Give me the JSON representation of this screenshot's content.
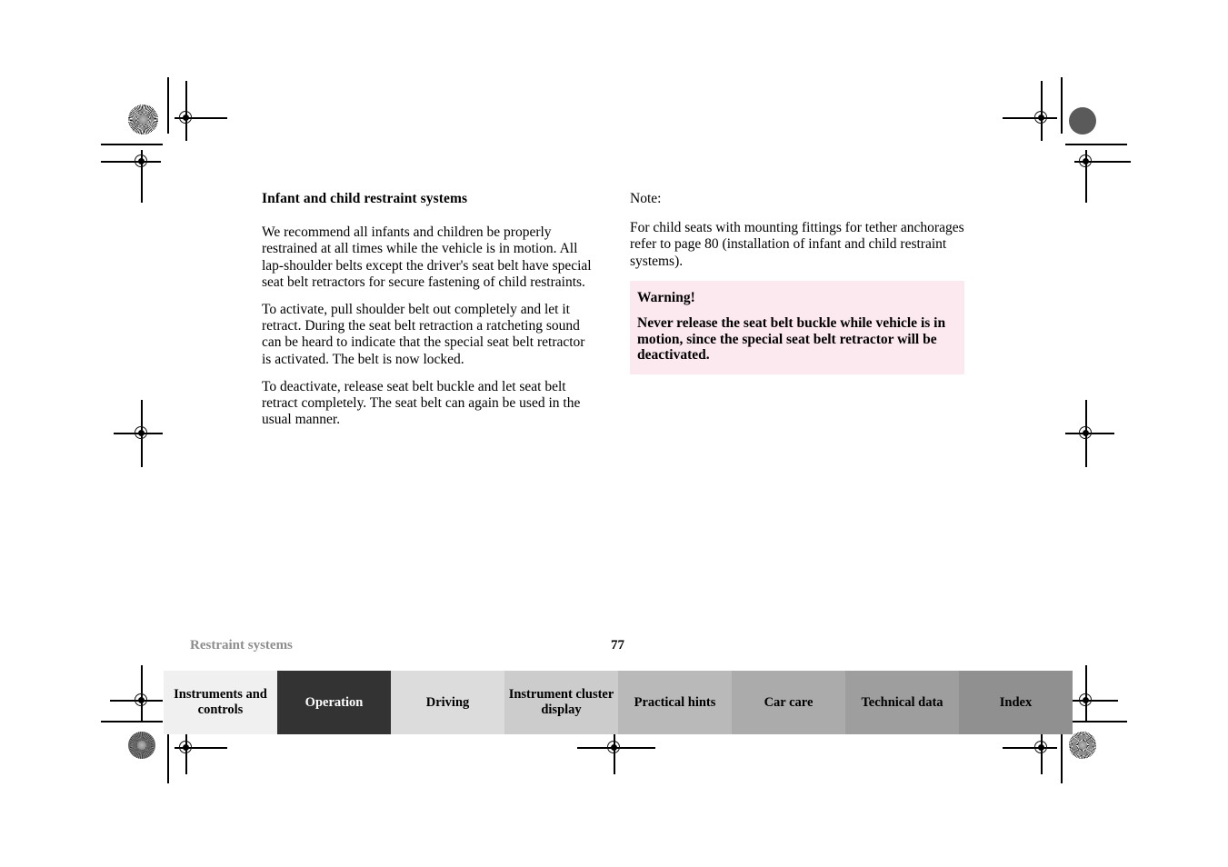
{
  "document": {
    "type": "vehicle-owners-manual-page",
    "page_number": "77",
    "footer_section": "Restraint systems"
  },
  "left_column": {
    "heading": "Infant and child restraint systems",
    "paragraphs": [
      "We recommend all infants and children be properly restrained at all times while the vehicle is in motion. All lap-shoulder belts except the driver's seat belt have special seat belt retractors for secure fastening of child restraints.",
      "To activate, pull shoulder belt out completely and let it retract. During the seat belt retraction a ratcheting sound can be heard to indicate that the special seat belt retractor is activated. The belt is now locked.",
      "To deactivate, release seat belt buckle and let seat belt retract completely. The seat belt can again be used in the usual manner."
    ]
  },
  "right_column": {
    "note_label": "Note:",
    "note_text": "For child seats with mounting fittings for tether anchorages refer to page 80 (installation of infant and child restraint systems).",
    "warning": {
      "title": "Warning!",
      "text": "Never release the seat belt buckle while vehicle is in motion, since the special seat belt retractor will be deactivated.",
      "background_color": "#fce9ef"
    }
  },
  "tab_bar": {
    "tabs": [
      {
        "label": "Instruments and controls",
        "color": "#f0f0f0",
        "active": false
      },
      {
        "label": "Operation",
        "color": "#333333",
        "active": true
      },
      {
        "label": "Driving",
        "color": "#dcdcdc",
        "active": false
      },
      {
        "label": "Instrument cluster display",
        "color": "#cccccc",
        "active": false
      },
      {
        "label": "Practical hints",
        "color": "#b9b9b9",
        "active": false
      },
      {
        "label": "Car care",
        "color": "#ababab",
        "active": false
      },
      {
        "label": "Technical data",
        "color": "#9e9e9e",
        "active": false
      },
      {
        "label": "Index",
        "color": "#909090",
        "active": false
      }
    ]
  },
  "registration_marks": {
    "description": "printer crop marks, crosshair targets and density patches",
    "patch_solid_color": "#5a5a5a"
  }
}
